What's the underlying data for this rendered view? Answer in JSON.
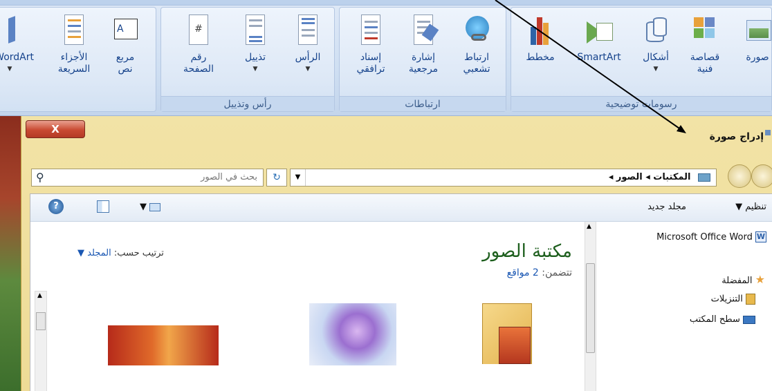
{
  "ribbon": {
    "groups": [
      {
        "label": "رسومات توضيحية",
        "buttons": [
          "صورة",
          "قصاصة فنية",
          "أشكال",
          "SmartArt",
          "مخطط"
        ]
      },
      {
        "label": "ارتباطات",
        "buttons": [
          "ارتباط تشعبي",
          "إشارة مرجعية",
          "إسناد ترافقي"
        ]
      },
      {
        "label": "رأس وتذييل",
        "buttons": [
          "الرأس",
          "تذييل",
          "رقم الصفحة"
        ]
      },
      {
        "label": "",
        "buttons": [
          "مربع نص",
          "الأجزاء السريعة",
          "WordArt"
        ]
      }
    ]
  },
  "dialog": {
    "title": "إدراج صورة",
    "close_label": "X",
    "breadcrumb": "المكتبات  ◂  الصور  ◂",
    "search_placeholder": "بحث في الصور",
    "toolbar": {
      "organize": "تنظيم",
      "new_folder": "مجلد جديد"
    },
    "nav_items": [
      {
        "label": "Microsoft Office Word",
        "icon": "word-icon"
      },
      {
        "label": "المفضلة",
        "icon": "star-icon"
      },
      {
        "label": "التنزيلات",
        "icon": "downloads-icon"
      },
      {
        "label": "سطح المكتب",
        "icon": "desktop-icon"
      }
    ],
    "library_title": "مكتبة الصور",
    "library_includes_label": "تتضمن:",
    "library_includes_value": "2 مواقع",
    "arrange_label": "ترتيب حسب:",
    "arrange_value": "المجلد"
  },
  "colors": {
    "ribbon_text": "#15428b",
    "dialog_frame": "#eedb96",
    "library_title": "#1e5f1e",
    "link": "#1a57b3"
  }
}
